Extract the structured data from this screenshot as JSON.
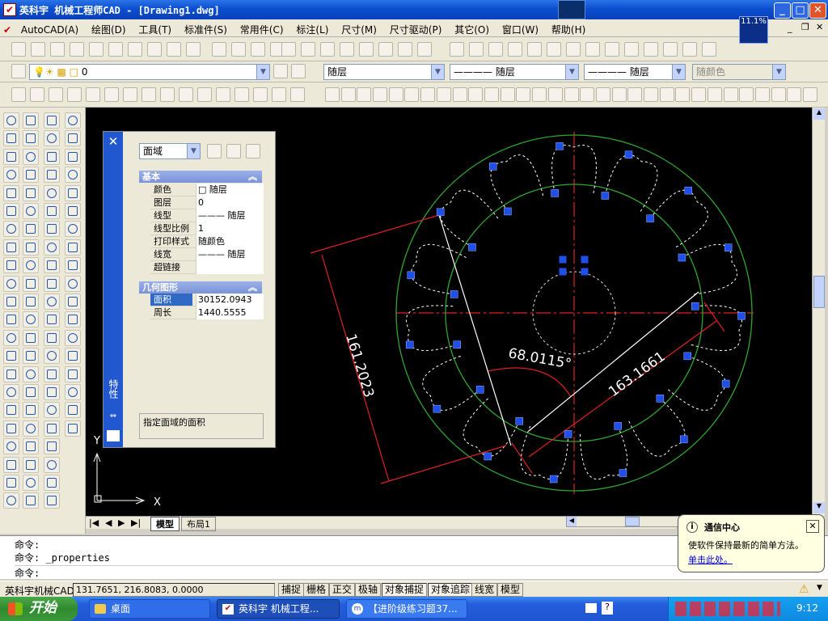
{
  "window": {
    "title": "英科宇 机械工程师CAD - [Drawing1.dwg]",
    "app_icon": "autocad-icon"
  },
  "menu": {
    "items": [
      "AutoCAD(A)",
      "绘图(D)",
      "工具(T)",
      "标准件(S)",
      "常用件(C)",
      "标注(L)",
      "尺寸(M)",
      "尺寸驱动(P)",
      "其它(O)",
      "窗口(W)",
      "帮助(H)"
    ]
  },
  "network_meter": "11.1%",
  "layer_combo": {
    "value": "0"
  },
  "color_combo": {
    "value": "随层"
  },
  "linetype_combo": {
    "value": "———— 随层"
  },
  "lineweight_combo": {
    "value": "———— 随层"
  },
  "plotstyle_combo": {
    "value": "随颜色"
  },
  "properties_panel": {
    "title": "特性",
    "object_type": "面域",
    "section_basic": "基本",
    "basic_rows": [
      {
        "key": "颜色",
        "value": "□ 随层"
      },
      {
        "key": "图层",
        "value": "0"
      },
      {
        "key": "线型",
        "value": "——— 随层"
      },
      {
        "key": "线型比例",
        "value": "1"
      },
      {
        "key": "打印样式",
        "value": "随颜色"
      },
      {
        "key": "线宽",
        "value": "——— 随层"
      },
      {
        "key": "超链接",
        "value": ""
      }
    ],
    "section_geometry": "几何图形",
    "geometry_rows": [
      {
        "key": "面积",
        "value": "30152.0943"
      },
      {
        "key": "周长",
        "value": "1440.5555"
      }
    ],
    "description": "指定面域的面积"
  },
  "drawing": {
    "dim_aligned_left": "161.2023",
    "dim_angle": "68.0115°",
    "dim_aligned_right": "163.1661",
    "ucs_x": "X",
    "ucs_y": "Y"
  },
  "layout_tabs": [
    "模型",
    "布局1"
  ],
  "command_lines": [
    "命令:",
    "命令: _properties",
    "命令:"
  ],
  "status": {
    "app_name": "英科宇机械CAD",
    "coords": "131.7651, 216.8083, 0.0000",
    "toggles": [
      "捕捉",
      "栅格",
      "正交",
      "极轴",
      "对象捕捉",
      "对象追踪",
      "线宽",
      "模型"
    ]
  },
  "balloon": {
    "title": "通信中心",
    "body": "使软件保持最新的简单方法。",
    "link": "单击此处。"
  },
  "taskbar": {
    "start": "开始",
    "tasks": [
      "桌面",
      "英科宇 机械工程...",
      "【进阶级练习题37..."
    ],
    "clock": "9:12"
  }
}
